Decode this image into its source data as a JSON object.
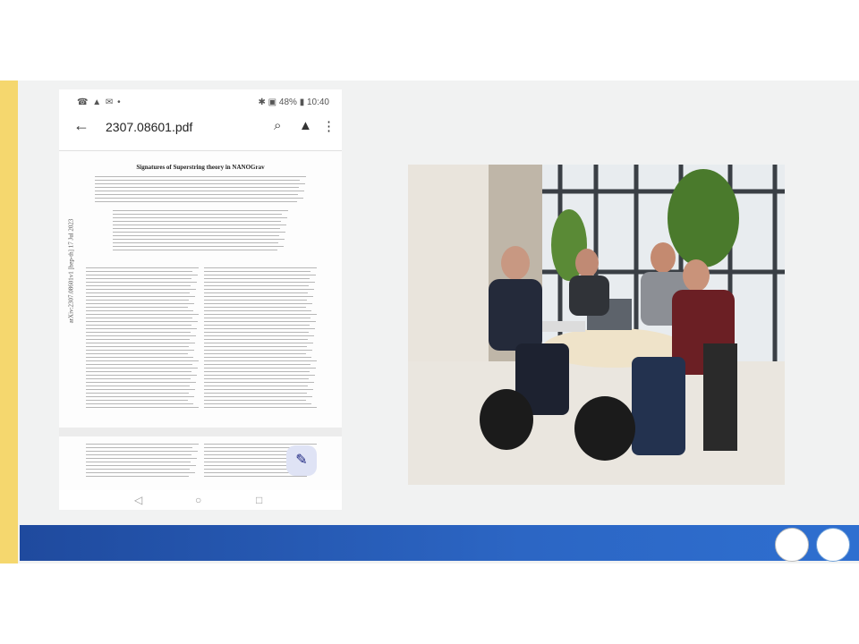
{
  "status_bar": {
    "left_icons": "☎ ▲ ✉ •",
    "right": "✱ ▣ 48% ▮ 10:40"
  },
  "app_bar": {
    "back_icon": "←",
    "file_name": "2307.08601.pdf",
    "icons": {
      "search": "⌕",
      "drive": "▲",
      "more": "⋮"
    }
  },
  "document": {
    "title": "Signatures of Superstring theory in NANOGrav",
    "arxiv_id": "arXiv:2307.08601v1 [hep-th] 17 Jul 2023"
  },
  "fab": {
    "icon": "✎"
  },
  "nav_bar": {
    "back": "◁",
    "home": "○",
    "recent": "□"
  },
  "colors": {
    "accent_bar": "#f5d76e",
    "footer_band": "#2c66c4",
    "slide_bg": "#f1f2f2"
  }
}
